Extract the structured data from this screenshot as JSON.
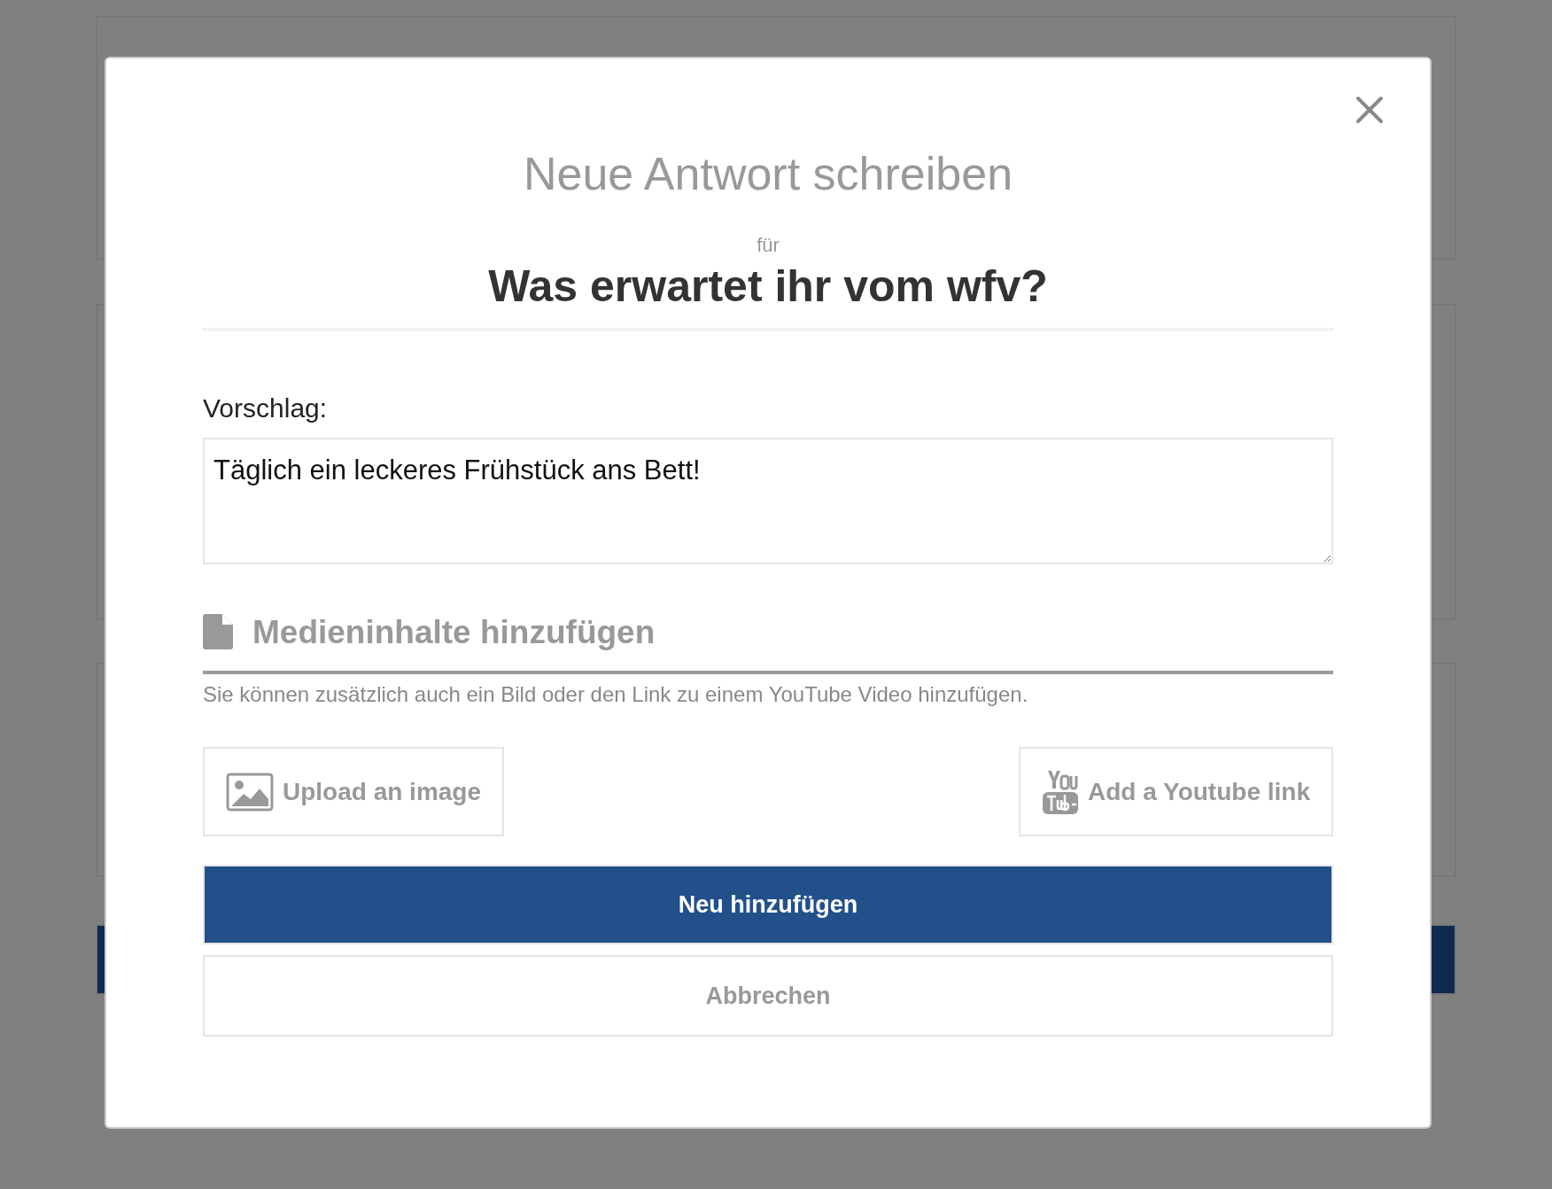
{
  "dialog": {
    "title": "Neue Antwort schreiben",
    "for_label": "für",
    "question": "Was erwartet ihr vom wfv?",
    "field": {
      "label": "Vorschlag:",
      "value": "Täglich ein leckeres Frühstück ans Bett!"
    },
    "media": {
      "heading": "Medieninhalte hinzufügen",
      "hint": "Sie können zusätzlich auch ein Bild oder den Link zu einem YouTube Video hinzufügen.",
      "buttons": [
        {
          "kind": "image",
          "label": "Upload an image"
        },
        {
          "kind": "youtube",
          "label": "Add a Youtube link"
        }
      ]
    },
    "actions": [
      {
        "kind": "primary",
        "label": "Neu hinzufügen"
      },
      {
        "kind": "secondary",
        "label": "Abbrechen"
      }
    ]
  }
}
